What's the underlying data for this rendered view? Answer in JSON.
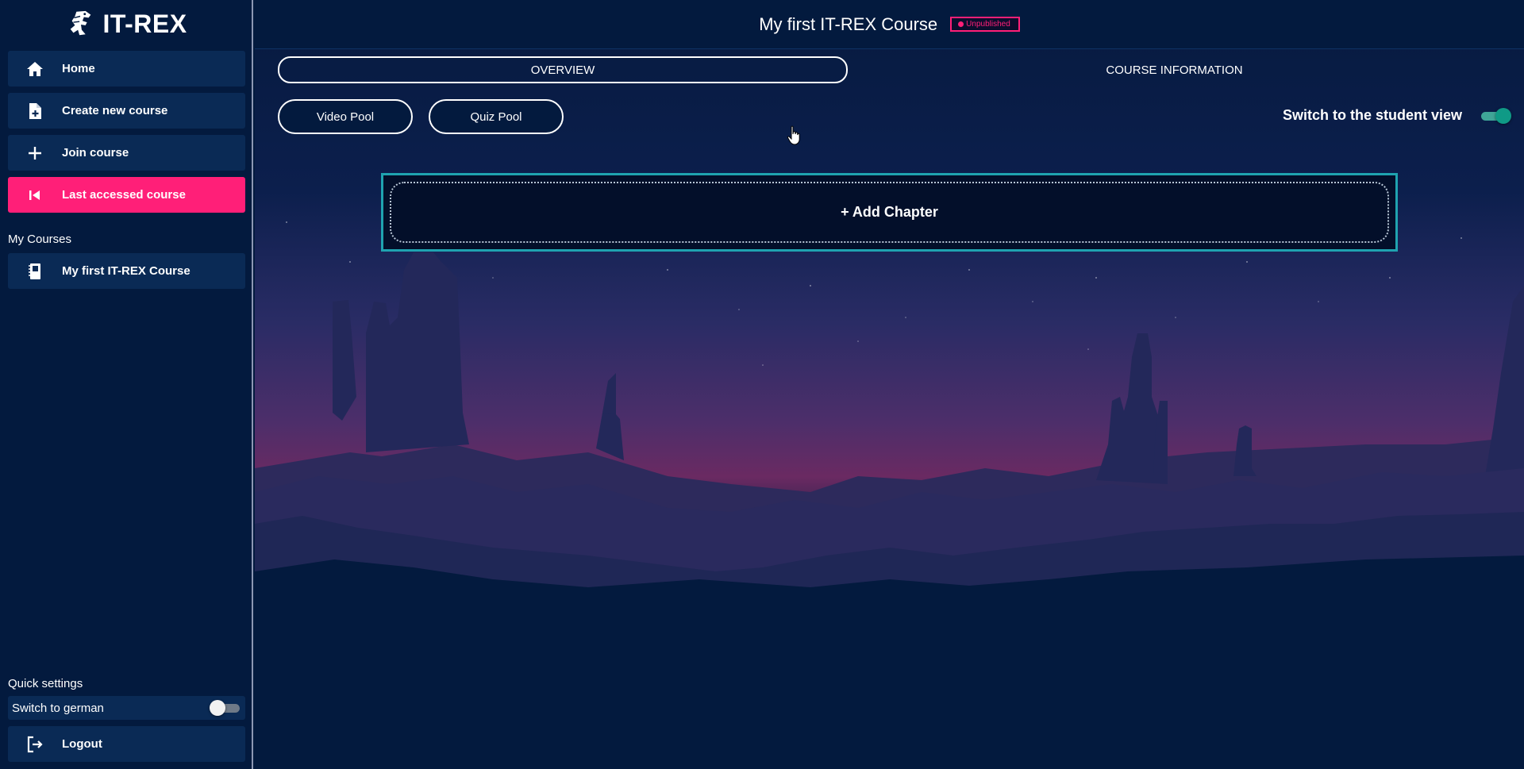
{
  "app": {
    "name": "IT-REX"
  },
  "sidebar": {
    "nav": [
      {
        "label": "Home",
        "icon": "home-icon"
      },
      {
        "label": "Create new course",
        "icon": "file-plus-icon"
      },
      {
        "label": "Join course",
        "icon": "plus-icon"
      },
      {
        "label": "Last accessed course",
        "icon": "skip-back-icon",
        "active": true
      }
    ],
    "my_courses_label": "My Courses",
    "courses": [
      {
        "label": "My first IT-REX Course",
        "icon": "notebook-icon"
      }
    ],
    "quick_settings_label": "Quick settings",
    "german_toggle": {
      "label": "Switch to german",
      "on": false
    },
    "logout_label": "Logout"
  },
  "header": {
    "course_title": "My first IT-REX Course",
    "status": "Unpublished"
  },
  "tabs": [
    {
      "label": "OVERVIEW",
      "active": true
    },
    {
      "label": "COURSE INFORMATION",
      "active": false
    }
  ],
  "pools": {
    "video": "Video Pool",
    "quiz": "Quiz Pool"
  },
  "student_view": {
    "label": "Switch to the student view",
    "on": true
  },
  "add_chapter_label": "+ Add Chapter",
  "colors": {
    "background": "#031a3e",
    "nav_item": "#0a2a55",
    "accent_pink": "#ff1f78",
    "teal": "#1fa3b0"
  }
}
